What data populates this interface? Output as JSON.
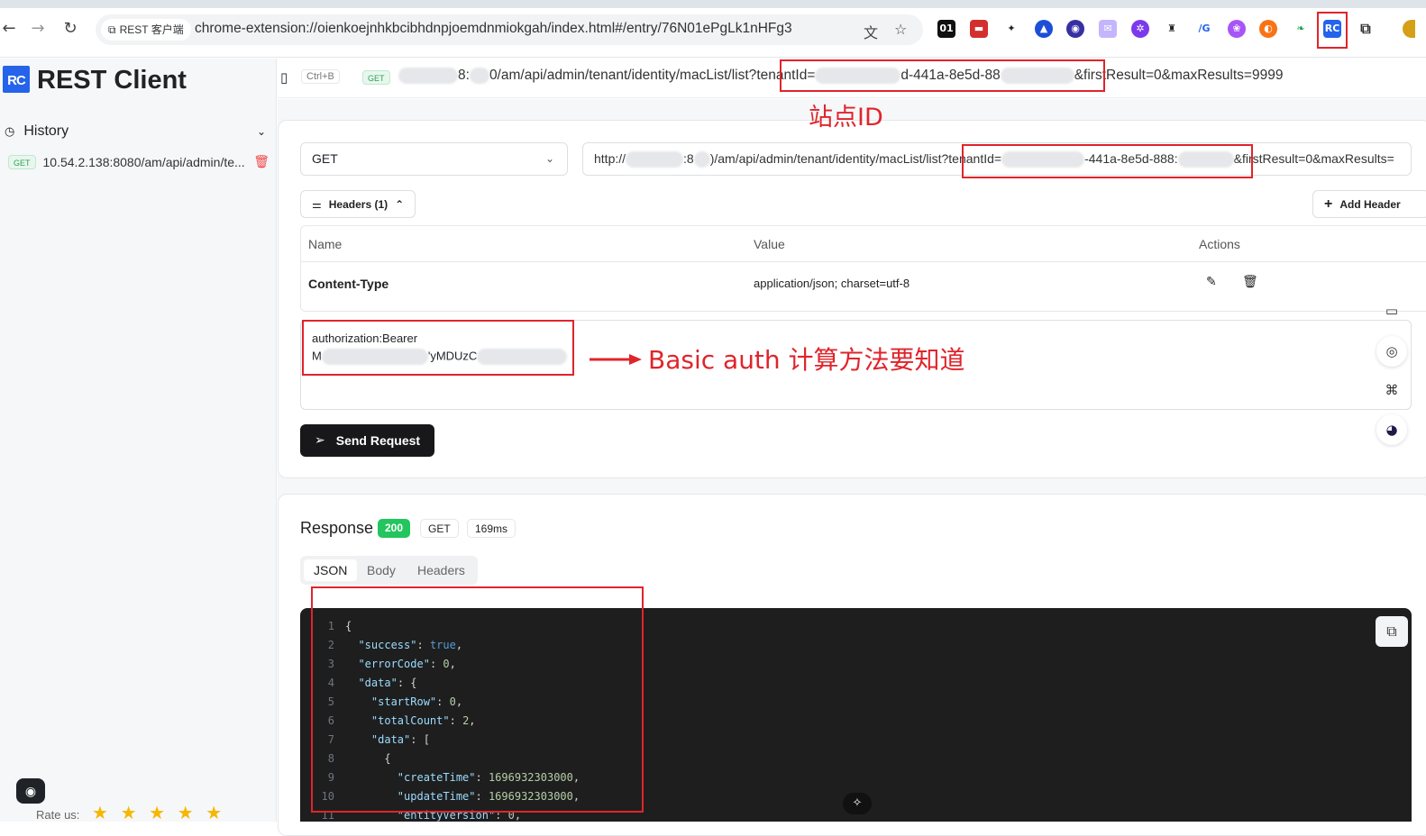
{
  "browser": {
    "site_chip": "REST 客户端",
    "url": "chrome-extension://oienkoejnhkbcibhdnpjoemdnmiokgah/index.html#/entry/76N01ePgLk1nHFg3",
    "extensions": [
      "01",
      "▬",
      "✦",
      "▲",
      "◉",
      "✉",
      "✲",
      "♜",
      "/G",
      "❀",
      "◐",
      "❧",
      "RC",
      "⧉"
    ]
  },
  "sidebar": {
    "logo": "RC",
    "title": "REST Client",
    "history_label": "History",
    "history_item": {
      "method": "GET",
      "url": "10.54.2.138:8080/am/api/admin/te..."
    },
    "rate_label": "Rate us:",
    "stars": [
      "★",
      "★",
      "★",
      "★",
      "★"
    ]
  },
  "topline": {
    "shortcut": "Ctrl+B",
    "method": "GET",
    "url_part1": "8:",
    "url_part2": "0/am/api/admin/tenant/identity/macList/list?",
    "url_tenant": "tenantId=",
    "url_tenant_tail": "d-441a-8e5d-88",
    "url_rest": "&firstResult=0&maxResults=9999"
  },
  "request": {
    "method": "GET",
    "url_prefix": "http://",
    "url_mid": ":8",
    "url_path": ")/am/api/admin/tenant/identity/macList/list?",
    "url_tenant": "tenantId=",
    "url_tenant_tail": "-441a-8e5d-888:",
    "url_rest": "&firstResult=0&maxResults=",
    "headers_toggle": "Headers (1)",
    "add_header": "Add Header",
    "columns": {
      "name": "Name",
      "value": "Value",
      "actions": "Actions"
    },
    "header_row": {
      "name": "Content-Type",
      "value": "application/json; charset=utf-8"
    },
    "auth_line1": "authorization:Bearer",
    "auth_line2a": "M",
    "auth_line2b": "'yMDUzC",
    "send": "Send Request"
  },
  "annotations": {
    "site_id": "站点ID",
    "basic_auth": "Basic auth 计算方法要知道"
  },
  "response": {
    "title": "Response",
    "status": "200",
    "method": "GET",
    "time": "169ms",
    "tabs": [
      "JSON",
      "Body",
      "Headers"
    ],
    "line_numbers": [
      "1",
      "2",
      "3",
      "4",
      "5",
      "6",
      "7",
      "8",
      "9",
      "10",
      "11"
    ]
  },
  "colors": {
    "accent": "#2563eb",
    "annotation": "#e0242b",
    "success": "#22c55e"
  }
}
